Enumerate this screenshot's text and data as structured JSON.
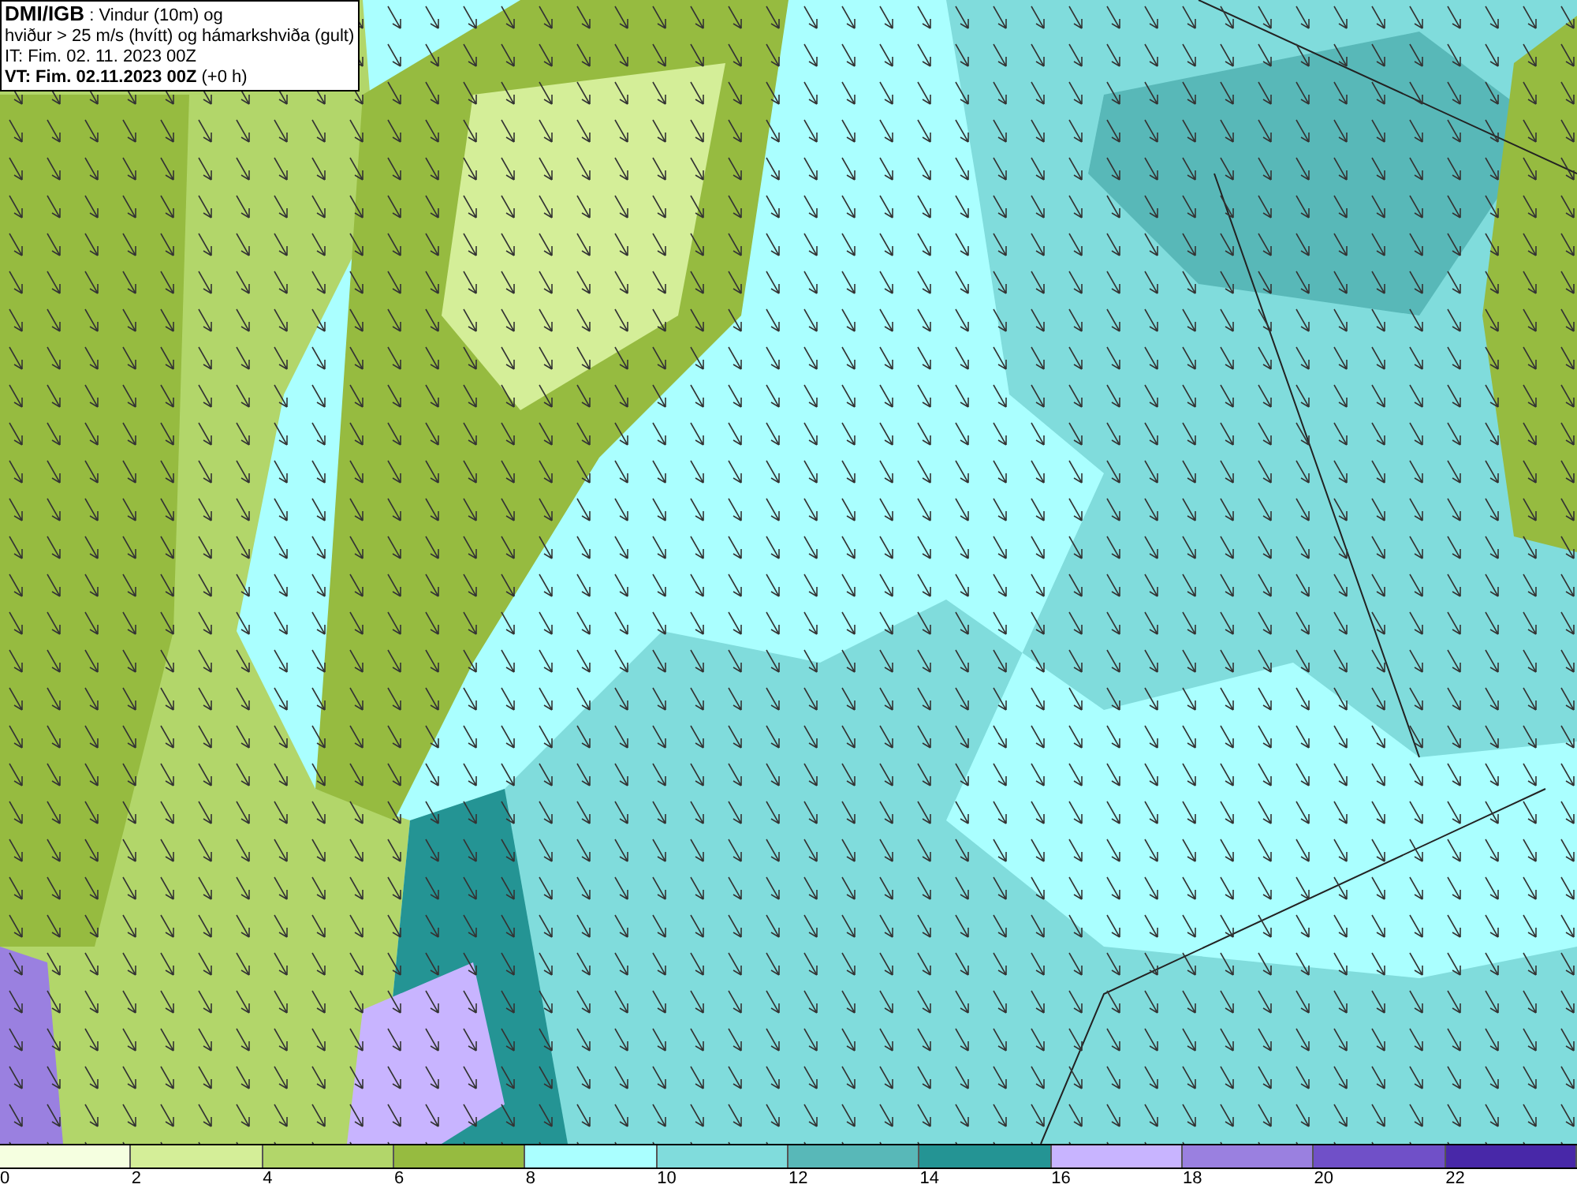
{
  "info": {
    "source": "DMI/IGB",
    "title": " : Vindur (10m) og",
    "subtitle": "hviður > 25 m/s (hvítt) og hámarkshviða (gult)",
    "initial_time": "IT: Fim. 02. 11. 2023 00Z",
    "valid_time": "**VT: Fim. 02.11.2023 00Z** (+0 h)"
  },
  "legend": [
    {
      "label": "0",
      "color": "#f5ffe0"
    },
    {
      "label": "2",
      "color": "#d4ee98"
    },
    {
      "label": "4",
      "color": "#b2d66a"
    },
    {
      "label": "6",
      "color": "#96bb40"
    },
    {
      "label": "8",
      "color": "#aaffff"
    },
    {
      "label": "10",
      "color": "#80dcdc"
    },
    {
      "label": "12",
      "color": "#58b8b8"
    },
    {
      "label": "14",
      "color": "#249494"
    },
    {
      "label": "16",
      "color": "#c8b4ff"
    },
    {
      "label": "18",
      "color": "#9a80e0"
    },
    {
      "label": "20",
      "color": "#7050c8"
    },
    {
      "label": "22",
      "color": "#4828a8"
    }
  ]
}
